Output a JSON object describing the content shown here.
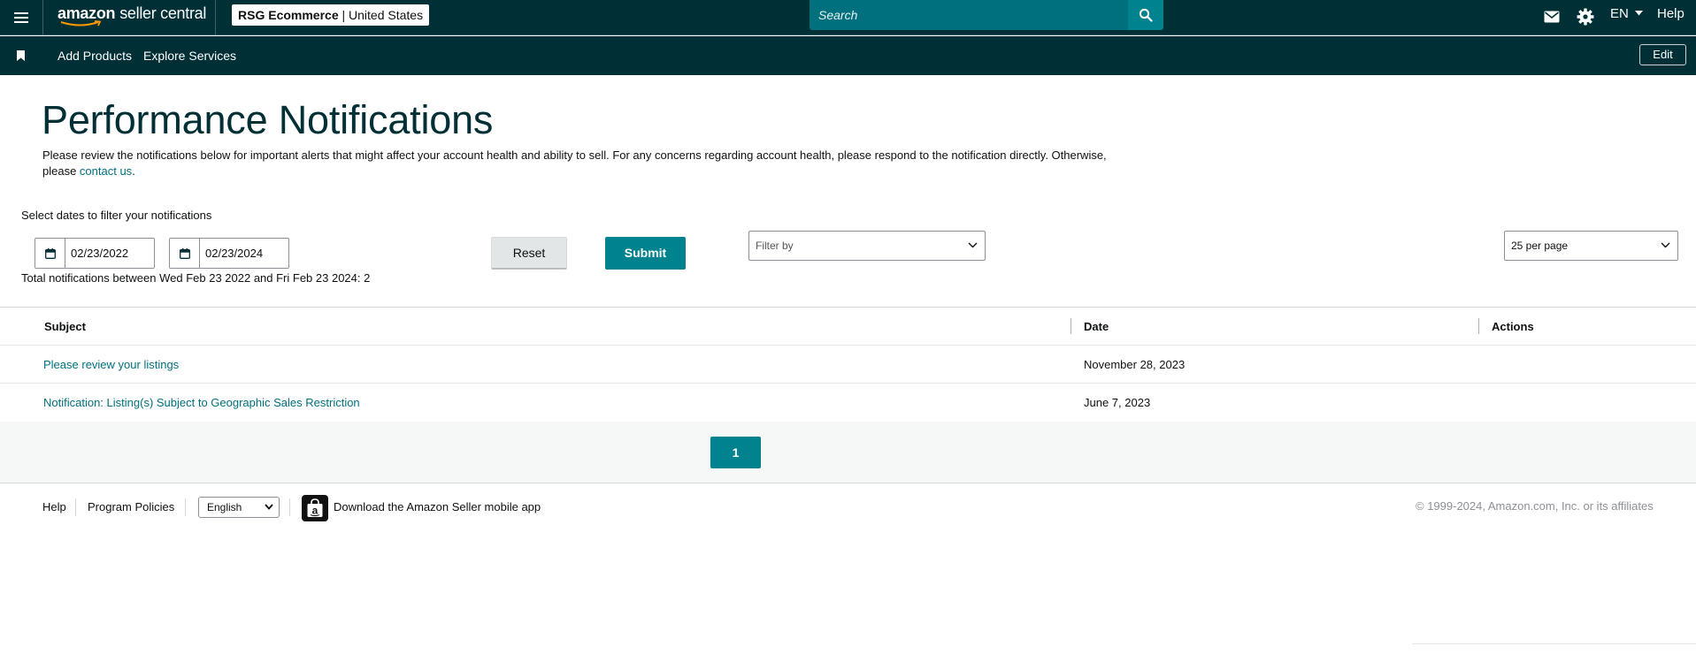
{
  "header": {
    "logo_bold": "amazon",
    "logo_text": "seller central",
    "account_store": "RSG Ecommerce",
    "account_sep": "|",
    "account_region": "United States",
    "search_placeholder": "Search",
    "language": "EN",
    "help": "Help"
  },
  "subnav": {
    "items": [
      "Add Products",
      "Explore Services"
    ],
    "edit": "Edit"
  },
  "page": {
    "title": "Performance Notifications",
    "intro_text": "Please review the notifications below for important alerts that might affect your account health and ability to sell. For any concerns regarding account health, please respond to the notification directly. Otherwise, please ",
    "intro_link": "contact us",
    "intro_end": "."
  },
  "filters": {
    "label": "Select dates to filter your notifications",
    "start_date": "02/23/2022",
    "end_date": "02/23/2024",
    "reset": "Reset",
    "submit": "Submit",
    "filter_by_placeholder": "Filter by",
    "per_page": "25 per page",
    "total": "Total notifications between Wed Feb 23 2022 and Fri Feb 23 2024: 2"
  },
  "table": {
    "headers": {
      "subject": "Subject",
      "date": "Date",
      "actions": "Actions"
    },
    "rows": [
      {
        "subject": "Please review your listings",
        "date": "November 28, 2023"
      },
      {
        "subject": "Notification: Listing(s) Subject to Geographic Sales Restriction",
        "date": "June 7, 2023"
      }
    ]
  },
  "pagination": {
    "current": "1"
  },
  "footer": {
    "help": "Help",
    "policies": "Program Policies",
    "language": "English",
    "app": "Download the Amazon Seller mobile app",
    "copyright": "© 1999-2024, Amazon.com, Inc. or its affiliates"
  },
  "colors": {
    "nav_bg": "#002f36",
    "accent": "#00838f",
    "link": "#00707e"
  }
}
